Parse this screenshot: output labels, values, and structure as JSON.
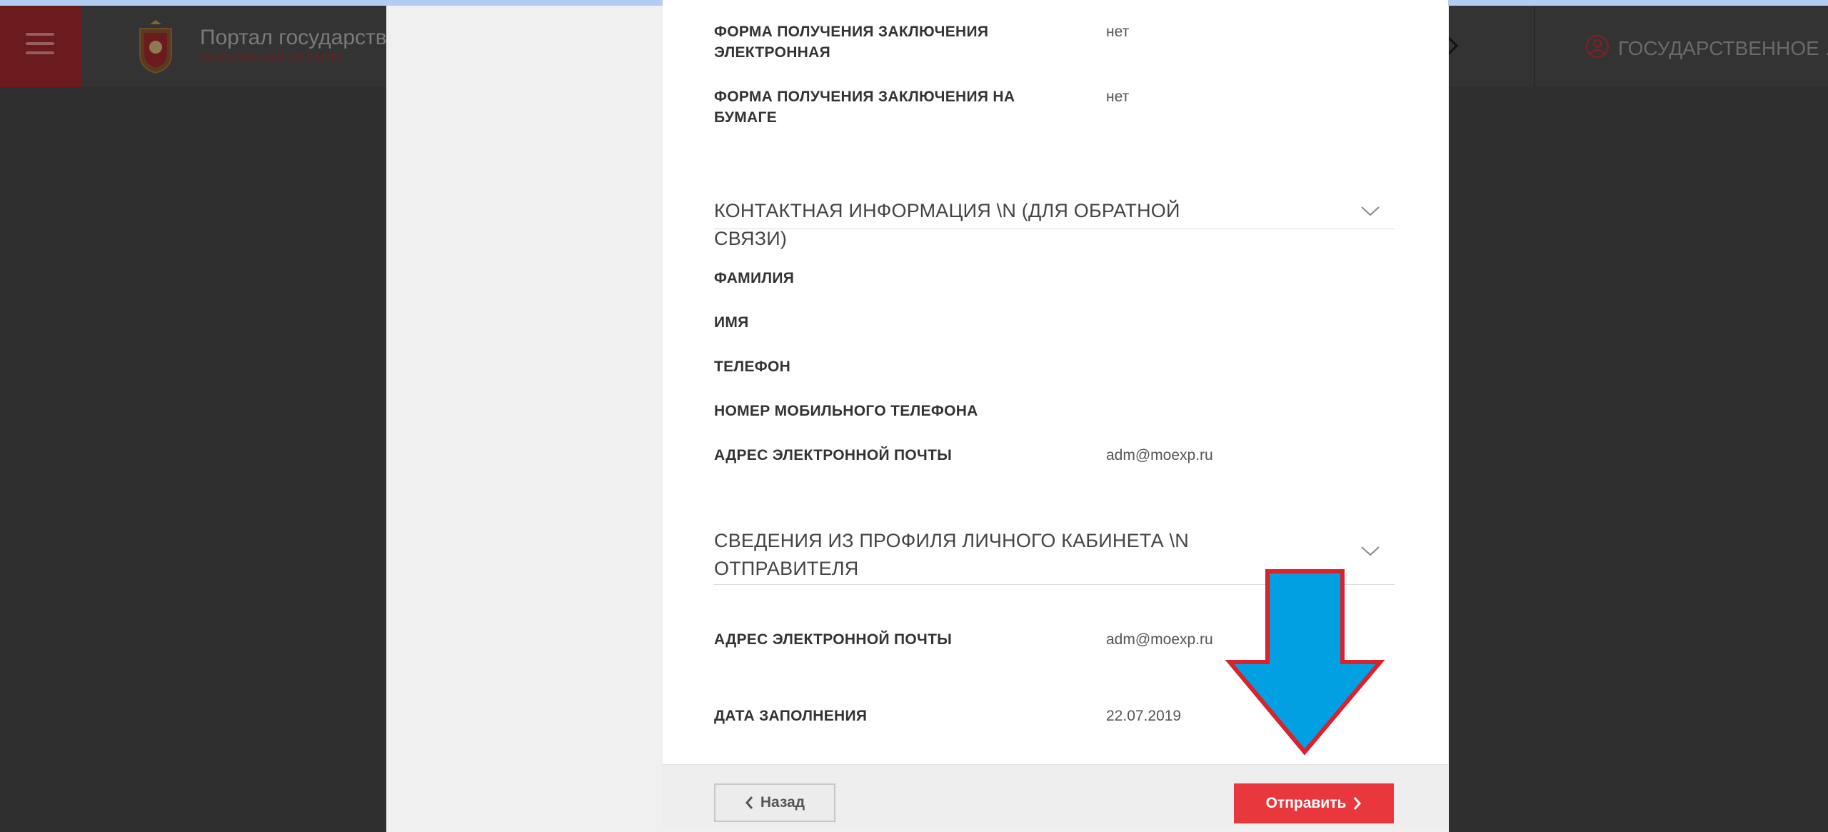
{
  "header": {
    "portal_title": "Портал государствен",
    "portal_subtitle": "МОСКОВСКОЙ ОБЛАСТИ",
    "user_name": "ГОСУДАРСТВЕННОЕ ..."
  },
  "form": {
    "rows_top": [
      {
        "label": "ФОРМА ПОЛУЧЕНИЯ ЗАКЛЮЧЕНИЯ ЭЛЕКТРОННАЯ",
        "value": "нет"
      },
      {
        "label": "ФОРМА ПОЛУЧЕНИЯ ЗАКЛЮЧЕНИЯ НА БУМАГЕ",
        "value": "нет"
      }
    ],
    "contact_section": {
      "title": "КОНТАКТНАЯ ИНФОРМАЦИЯ \\N (ДЛЯ ОБРАТНОЙ СВЯЗИ)",
      "rows": [
        {
          "label": "ФАМИЛИЯ",
          "value": ""
        },
        {
          "label": "ИМЯ",
          "value": ""
        },
        {
          "label": "ТЕЛЕФОН",
          "value": ""
        },
        {
          "label": "НОМЕР МОБИЛЬНОГО ТЕЛЕФОНА",
          "value": ""
        },
        {
          "label": "АДРЕС ЭЛЕКТРОННОЙ ПОЧТЫ",
          "value": "adm@moexp.ru"
        }
      ]
    },
    "profile_section": {
      "title": "СВЕДЕНИЯ ИЗ ПРОФИЛЯ ЛИЧНОГО КАБИНЕТА \\N ОТПРАВИТЕЛЯ",
      "rows": [
        {
          "label": "АДРЕС ЭЛЕКТРОННОЙ ПОЧТЫ",
          "value": "adm@moexp.ru"
        },
        {
          "label": "ДАТА ЗАПОЛНЕНИЯ",
          "value": "22.07.2019"
        }
      ]
    }
  },
  "footer": {
    "back_label": "Назад",
    "send_label": "Отправить"
  },
  "colors": {
    "accent": "#e8383d",
    "arrow_fill": "#00a0e3",
    "arrow_stroke": "#d9222b"
  },
  "icons": [
    "menu-icon",
    "crest-icon",
    "chevron-right-icon",
    "user-icon",
    "chevron-down-icon",
    "chevron-left-icon",
    "arrow-down-icon"
  ]
}
